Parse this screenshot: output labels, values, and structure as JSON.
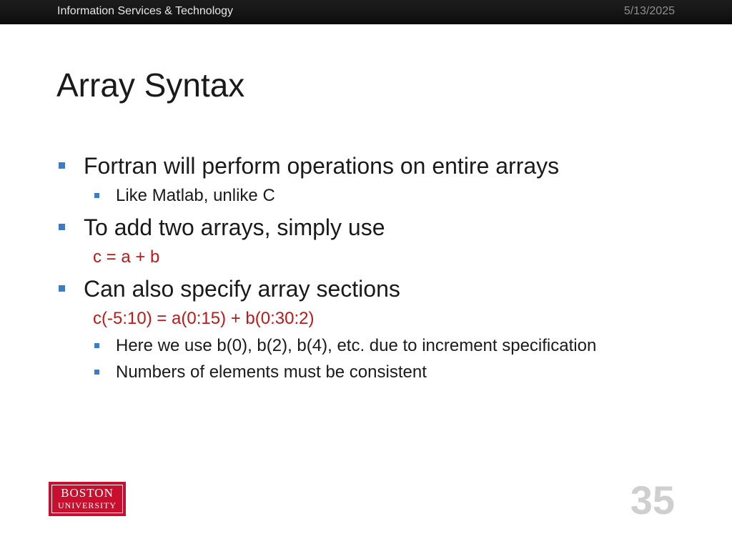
{
  "header": {
    "organization": "Information Services & Technology",
    "date": "5/13/2025"
  },
  "slide": {
    "title": "Array Syntax",
    "number": "35"
  },
  "bullets": [
    {
      "text": "Fortran will perform operations on entire arrays",
      "sub": [
        "Like Matlab, unlike C"
      ]
    },
    {
      "text": "To add two arrays, simply use",
      "code": "c = a + b"
    },
    {
      "text": "Can also specify array sections",
      "code": "c(-5:10) = a(0:15) + b(0:30:2)",
      "sub": [
        "Here we use b(0), b(2), b(4), etc. due to increment specification",
        "Numbers of elements must be consistent"
      ]
    }
  ],
  "logo": {
    "line1": "BOSTON",
    "line2": "UNIVERSITY"
  },
  "colors": {
    "bullet": "#3d7cc4",
    "code": "#c01818",
    "logo_bg": "#c8102e",
    "header_bg": "#141414"
  }
}
